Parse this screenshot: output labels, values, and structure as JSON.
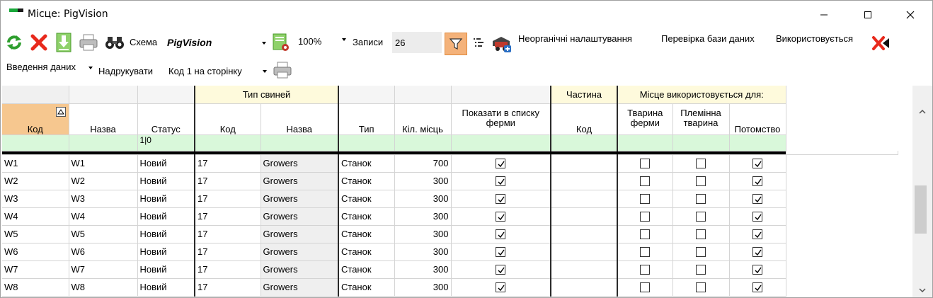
{
  "window": {
    "title": "Місце: PigVision"
  },
  "toolbar": {
    "refresh_icon": "refresh-icon",
    "delete_icon": "delete-icon",
    "export_icon": "export-icon",
    "print_icon": "printer-icon",
    "find_icon": "binoculars-icon",
    "scheme_label": "Схема",
    "scheme_value": "PigVision",
    "scheme_settings_icon": "scheme-settings-icon",
    "zoom_value": "100%",
    "records_label": "Записи",
    "records_value": "26",
    "filter_icon": "filter-icon",
    "columns_icon": "column-chooser-icon",
    "database_icon": "database-icon",
    "inorganic_settings": "Неорганічні налаштування",
    "check_database": "Перевірка бази даних",
    "used_label": "Використовується",
    "clear_icon": "clear-icon"
  },
  "toolbar2": {
    "data_entry": "Введення даних",
    "print_label": "Надрукувати",
    "print_option": "Код 1 на сторінку",
    "print_icon": "printer-icon"
  },
  "grid": {
    "group_headers": {
      "pig_type": "Тип свиней",
      "part": "Частина",
      "place_used_for": "Місце використовується для:"
    },
    "columns": [
      "Код",
      "Назва",
      "Статус",
      "Код",
      "Назва",
      "Тип",
      "Кіл. місць",
      "Показати в списку ферми",
      "Код",
      "Тварина ферми",
      "Племінна тварина",
      "Потомство"
    ],
    "filter_status": "1|0",
    "rows": [
      {
        "code": "W1",
        "name": "W1",
        "status": "Новий",
        "pig_code": "17",
        "pig_name": "Growers",
        "type": "Станок",
        "places": "700",
        "show_in_farm_list": true,
        "part_code": "",
        "farm_animal": false,
        "breeding_animal": false,
        "offspring": true
      },
      {
        "code": "W2",
        "name": "W2",
        "status": "Новий",
        "pig_code": "17",
        "pig_name": "Growers",
        "type": "Станок",
        "places": "300",
        "show_in_farm_list": true,
        "part_code": "",
        "farm_animal": false,
        "breeding_animal": false,
        "offspring": true
      },
      {
        "code": "W3",
        "name": "W3",
        "status": "Новий",
        "pig_code": "17",
        "pig_name": "Growers",
        "type": "Станок",
        "places": "300",
        "show_in_farm_list": true,
        "part_code": "",
        "farm_animal": false,
        "breeding_animal": false,
        "offspring": true
      },
      {
        "code": "W4",
        "name": "W4",
        "status": "Новий",
        "pig_code": "17",
        "pig_name": "Growers",
        "type": "Станок",
        "places": "300",
        "show_in_farm_list": true,
        "part_code": "",
        "farm_animal": false,
        "breeding_animal": false,
        "offspring": true
      },
      {
        "code": "W5",
        "name": "W5",
        "status": "Новий",
        "pig_code": "17",
        "pig_name": "Growers",
        "type": "Станок",
        "places": "300",
        "show_in_farm_list": true,
        "part_code": "",
        "farm_animal": false,
        "breeding_animal": false,
        "offspring": true
      },
      {
        "code": "W6",
        "name": "W6",
        "status": "Новий",
        "pig_code": "17",
        "pig_name": "Growers",
        "type": "Станок",
        "places": "300",
        "show_in_farm_list": true,
        "part_code": "",
        "farm_animal": false,
        "breeding_animal": false,
        "offspring": true
      },
      {
        "code": "W7",
        "name": "W7",
        "status": "Новий",
        "pig_code": "17",
        "pig_name": "Growers",
        "type": "Станок",
        "places": "300",
        "show_in_farm_list": true,
        "part_code": "",
        "farm_animal": false,
        "breeding_animal": false,
        "offspring": true
      },
      {
        "code": "W8",
        "name": "W8",
        "status": "Новий",
        "pig_code": "17",
        "pig_name": "Growers",
        "type": "Станок",
        "places": "300",
        "show_in_farm_list": true,
        "part_code": "",
        "farm_animal": false,
        "breeding_animal": false,
        "offspring": true
      }
    ]
  },
  "colors": {
    "filter_active": "#f4b27a",
    "filter_row": "#d9f8da",
    "group_header": "#fefadc",
    "sorted_header": "#f6c78f"
  }
}
